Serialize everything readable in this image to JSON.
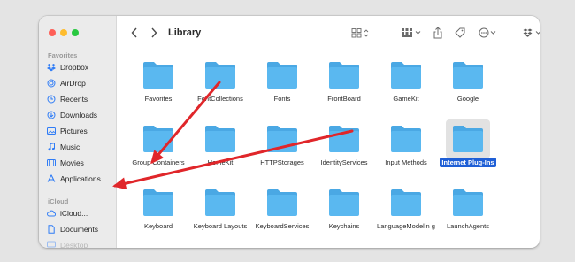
{
  "sidebar": {
    "favorites_label": "Favorites",
    "favorites": [
      {
        "label": "Dropbox",
        "icon": "dropbox-icon"
      },
      {
        "label": "AirDrop",
        "icon": "airdrop-icon"
      },
      {
        "label": "Recents",
        "icon": "clock-icon"
      },
      {
        "label": "Downloads",
        "icon": "download-icon"
      },
      {
        "label": "Pictures",
        "icon": "photo-icon"
      },
      {
        "label": "Music",
        "icon": "music-note-icon"
      },
      {
        "label": "Movies",
        "icon": "film-icon"
      },
      {
        "label": "Applications",
        "icon": "apps-icon"
      }
    ],
    "icloud_label": "iCloud",
    "icloud": [
      {
        "label": "iCloud...",
        "icon": "cloud-icon"
      },
      {
        "label": "Documents",
        "icon": "document-icon"
      },
      {
        "label": "Desktop",
        "icon": "desktop-icon"
      }
    ]
  },
  "toolbar": {
    "title": "Library",
    "icons": [
      "chevron-left-icon",
      "chevron-right-icon",
      "grid-view-icon",
      "group-icon",
      "share-icon",
      "tag-icon",
      "more-icon",
      "dropbox-icon",
      "search-icon"
    ]
  },
  "folders": [
    {
      "label": "Favorites"
    },
    {
      "label": "FontCollections"
    },
    {
      "label": "Fonts"
    },
    {
      "label": "FrontBoard"
    },
    {
      "label": "GameKit"
    },
    {
      "label": "Google"
    },
    {
      "label": "Group Containers"
    },
    {
      "label": "HomeKit"
    },
    {
      "label": "HTTPStorages"
    },
    {
      "label": "IdentityServices"
    },
    {
      "label": "Input Methods"
    },
    {
      "label": "Internet Plug-Ins",
      "selected": true
    },
    {
      "label": "Keyboard"
    },
    {
      "label": "Keyboard Layouts"
    },
    {
      "label": "KeyboardServices"
    },
    {
      "label": "Keychains"
    },
    {
      "label": "LanguageModelin g"
    },
    {
      "label": "LaunchAgents"
    }
  ],
  "colors": {
    "folder": "#5ab8f0",
    "folder_tab": "#4aa8e4",
    "selection": "#1f5fd6",
    "annotation_arrow": "#e0262a",
    "accent": "#2f7cf6"
  }
}
